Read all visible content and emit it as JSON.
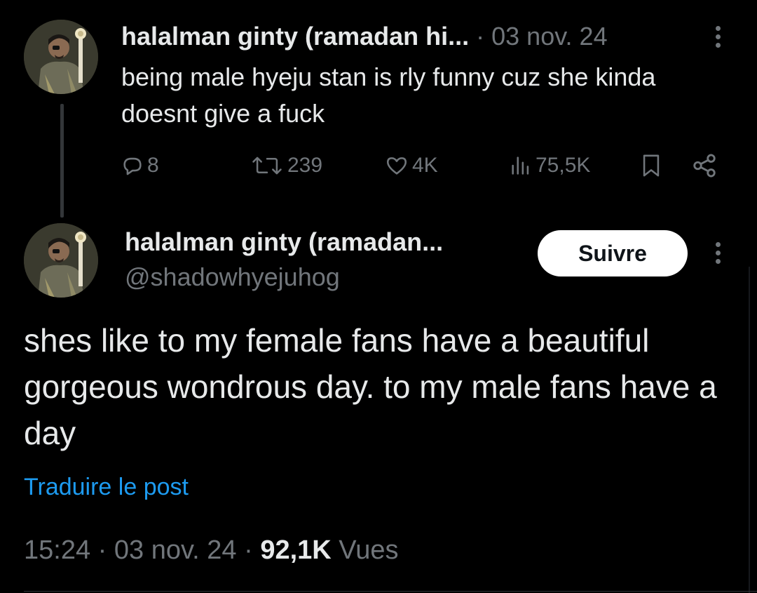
{
  "tweet1": {
    "display_name": "halalman ginty (ramadan hi...",
    "separator": "·",
    "date": "03 nov. 24",
    "text": "being male hyeju stan is rly funny cuz she kinda doesnt give a fuck",
    "replies": "8",
    "retweets": "239",
    "likes": "4K",
    "views": "75,5K"
  },
  "tweet2": {
    "display_name": "halalman ginty (ramadan...",
    "handle": "@shadowhyejuhog",
    "follow_label": "Suivre",
    "text": "shes like to my female fans have a beautiful gorgeous wondrous day. to my male fans have a day",
    "translate_label": "Traduire le post",
    "time": "15:24",
    "sep1": "·",
    "date": "03 nov. 24",
    "sep2": "·",
    "views_count": "92,1K",
    "views_label": "Vues"
  },
  "icons": {
    "reply": "reply-icon",
    "retweet": "retweet-icon",
    "like": "heart-icon",
    "views": "views-icon",
    "bookmark": "bookmark-icon",
    "share": "share-icon",
    "more": "more-dots-icon"
  },
  "colors": {
    "background": "#000000",
    "text": "#e7e9ea",
    "muted": "#71767b",
    "link": "#1d9bf0",
    "follow_bg": "#ffffff"
  }
}
